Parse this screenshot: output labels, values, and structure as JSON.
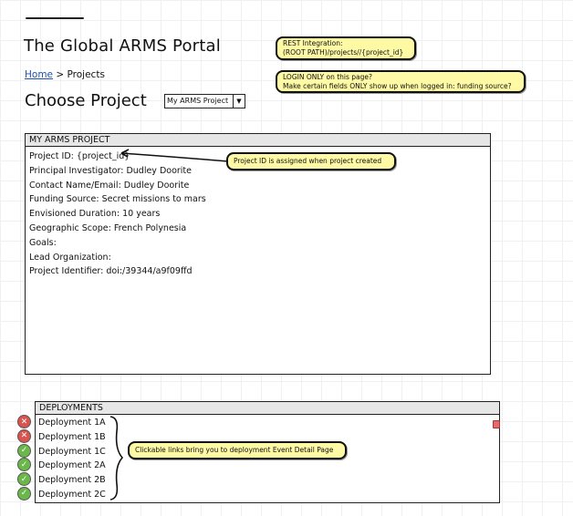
{
  "header": {
    "title": "The Global ARMS Portal"
  },
  "breadcrumb": {
    "home": "Home",
    "separator": ">",
    "current": "Projects"
  },
  "chooser": {
    "label": "Choose Project",
    "selected": "My ARMS Project",
    "arrow": "▼"
  },
  "notes": {
    "rest_line1": "REST Integration:",
    "rest_line2": "(ROOT PATH)/projects//{project_id}",
    "login_line1": "LOGIN ONLY on this page?",
    "login_line2": "Make certain fields ONLY show up when logged in: funding source?",
    "project_id": "Project ID is assigned when project created",
    "deployments": "Clickable links bring you to deployment Event Detail Page"
  },
  "project_panel": {
    "heading": "MY ARMS PROJECT",
    "fields": [
      "Project ID: {project_id}",
      "Principal Investigator:  Dudley Doorite",
      "Contact Name/Email:  Dudley Doorite",
      "Funding Source:   Secret missions to mars",
      "Envisioned Duration:   10 years",
      "Geographic Scope:   French Polynesia",
      "Goals:",
      "Lead Organization:",
      "Project Identifier:  doi:/39344/a9f09ffd"
    ]
  },
  "deployments_panel": {
    "heading": "DEPLOYMENTS",
    "items": [
      {
        "label": "Deployment 1A",
        "status": "error",
        "icon": "error-icon",
        "color": "#d9534f",
        "glyph": "✕"
      },
      {
        "label": "Deployment 1B",
        "status": "error",
        "icon": "error-icon",
        "color": "#d9534f",
        "glyph": "✕"
      },
      {
        "label": "Deployment 1C",
        "status": "ok",
        "icon": "check-icon",
        "color": "#6bb84a",
        "glyph": "✓"
      },
      {
        "label": "Deployment 2A",
        "status": "ok",
        "icon": "check-icon",
        "color": "#6bb84a",
        "glyph": "✓"
      },
      {
        "label": "Deployment 2B",
        "status": "ok",
        "icon": "check-icon",
        "color": "#6bb84a",
        "glyph": "✓"
      },
      {
        "label": "Deployment 2C",
        "status": "ok",
        "icon": "check-icon",
        "color": "#6bb84a",
        "glyph": "✓"
      }
    ]
  },
  "colors": {
    "note_bg": "#fdf9a4",
    "link": "#1f4fb0",
    "panel_header": "#e6e6e6"
  }
}
